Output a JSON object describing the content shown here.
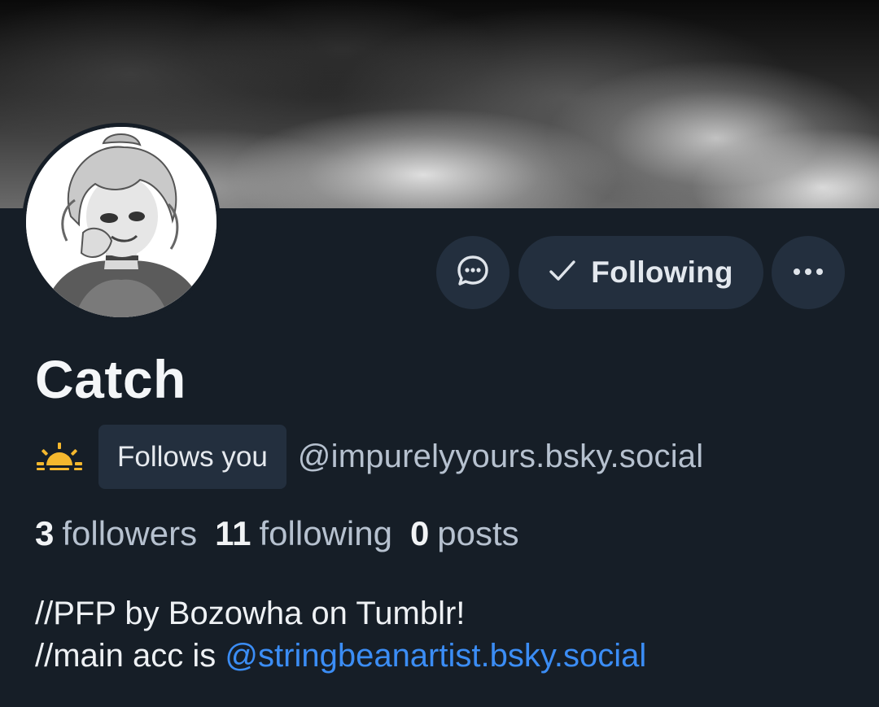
{
  "profile": {
    "display_name": "Catch",
    "handle": "@impurelyyours.bsky.social",
    "follows_you_label": "Follows you",
    "status_emoji": "sun-emoji"
  },
  "actions": {
    "message_icon": "message-bubble-icon",
    "follow_label": "Following",
    "follow_check_icon": "checkmark-icon",
    "more_icon": "ellipsis-icon"
  },
  "stats": {
    "followers_count": "3",
    "followers_label": "followers",
    "following_count": "11",
    "following_label": "following",
    "posts_count": "0",
    "posts_label": "posts"
  },
  "bio": {
    "line1": "//PFP by Bozowha on Tumblr!",
    "line2_prefix": "//main acc is ",
    "line2_link": "@stringbeanartist.bsky.social"
  },
  "colors": {
    "background": "#161e27",
    "button_bg": "#232f3e",
    "secondary_text": "#b6c1cf",
    "link": "#3b8df5"
  }
}
